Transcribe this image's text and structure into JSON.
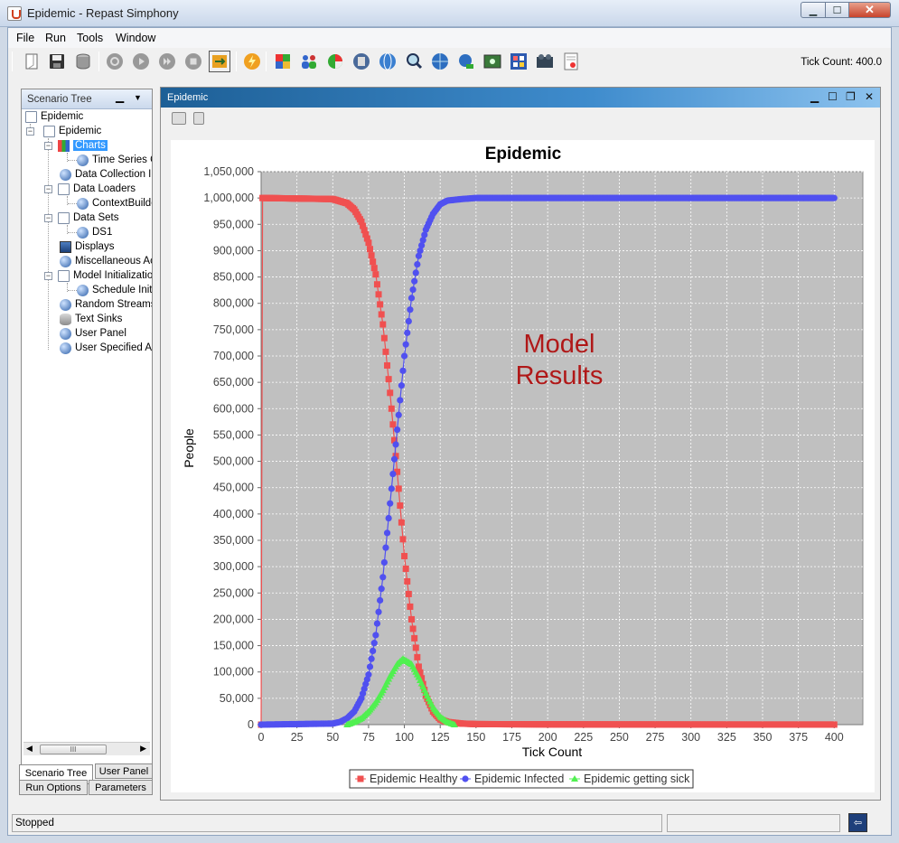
{
  "window": {
    "title": "Epidemic - Repast Simphony",
    "min_glyph": "▁",
    "max_glyph": "☐",
    "close_glyph": "✕"
  },
  "menu": {
    "items": [
      "File",
      "Run",
      "Tools",
      "Window"
    ]
  },
  "toolbar": {
    "tick_count_label": "Tick Count: 400.0",
    "buttons": [
      {
        "icon": "open-icon"
      },
      {
        "icon": "save-icon"
      },
      {
        "icon": "database-icon"
      },
      {
        "icon": "init-icon"
      },
      {
        "icon": "play-icon"
      },
      {
        "icon": "step-icon"
      },
      {
        "icon": "stop-icon"
      },
      {
        "icon": "reset-icon"
      },
      {
        "icon": "flash-icon"
      },
      {
        "icon": "colors-icon"
      },
      {
        "icon": "people-icon"
      },
      {
        "icon": "pie-icon"
      },
      {
        "icon": "calculator-icon"
      },
      {
        "icon": "globe-icon"
      },
      {
        "icon": "magnifier-icon"
      },
      {
        "icon": "web-icon"
      },
      {
        "icon": "network-icon"
      },
      {
        "icon": "image-icon"
      },
      {
        "icon": "grid-icon"
      },
      {
        "icon": "film-icon"
      },
      {
        "icon": "report-icon"
      }
    ]
  },
  "scenario_tree": {
    "header": "Scenario Tree",
    "nodes": [
      {
        "label": "Epidemic"
      },
      {
        "label": "Epidemic"
      },
      {
        "label": "Charts"
      },
      {
        "label": "Time Series C"
      },
      {
        "label": "Data Collection In"
      },
      {
        "label": "Data Loaders"
      },
      {
        "label": "ContextBuilde"
      },
      {
        "label": "Data Sets"
      },
      {
        "label": "DS1"
      },
      {
        "label": "Displays"
      },
      {
        "label": "Miscellaneous Act"
      },
      {
        "label": "Model Initializatio"
      },
      {
        "label": "Schedule Init"
      },
      {
        "label": "Random Streams"
      },
      {
        "label": "Text Sinks"
      },
      {
        "label": "User Panel"
      },
      {
        "label": "User Specified Ac"
      }
    ],
    "scroll_thumb": "III"
  },
  "bottom_tabs": {
    "scenario_tree": "Scenario Tree",
    "user_panel": "User Panel",
    "run_options": "Run Options",
    "parameters": "Parameters"
  },
  "chart_window": {
    "title": "Epidemic"
  },
  "annotation": {
    "line1": "Model",
    "line2": "Results"
  },
  "status": {
    "text": "Stopped"
  },
  "chart_data": {
    "type": "line",
    "title": "Epidemic",
    "xlabel": "Tick Count",
    "ylabel": "People",
    "xlim": [
      0,
      420
    ],
    "ylim": [
      0,
      1050000
    ],
    "x_ticks": [
      0,
      25,
      50,
      75,
      100,
      125,
      150,
      175,
      200,
      225,
      250,
      275,
      300,
      325,
      350,
      375,
      400
    ],
    "y_ticks": [
      0,
      50000,
      100000,
      150000,
      200000,
      250000,
      300000,
      350000,
      400000,
      450000,
      500000,
      550000,
      600000,
      650000,
      700000,
      750000,
      800000,
      850000,
      900000,
      950000,
      1000000,
      1050000
    ],
    "grid": true,
    "legend_position": "bottom",
    "colors": {
      "healthy": "#f05050",
      "infected": "#5050f0",
      "sick": "#50f050",
      "plot_bg": "#c0c0c0",
      "annotation": "#b01818"
    },
    "series": [
      {
        "name": "Epidemic Healthy",
        "marker": "square",
        "points": [
          [
            0,
            0
          ],
          [
            1,
            1000000
          ],
          [
            50,
            998000
          ],
          [
            60,
            990000
          ],
          [
            65,
            978000
          ],
          [
            70,
            955000
          ],
          [
            75,
            915000
          ],
          [
            80,
            855000
          ],
          [
            85,
            760000
          ],
          [
            90,
            630000
          ],
          [
            95,
            480000
          ],
          [
            100,
            320000
          ],
          [
            105,
            200000
          ],
          [
            110,
            110000
          ],
          [
            115,
            55000
          ],
          [
            120,
            25000
          ],
          [
            125,
            10000
          ],
          [
            130,
            5000
          ],
          [
            140,
            2000
          ],
          [
            150,
            1000
          ],
          [
            200,
            500
          ],
          [
            250,
            300
          ],
          [
            300,
            200
          ],
          [
            350,
            100
          ],
          [
            400,
            100
          ]
        ]
      },
      {
        "name": "Epidemic Infected",
        "marker": "circle",
        "points": [
          [
            0,
            0
          ],
          [
            50,
            2000
          ],
          [
            55,
            5000
          ],
          [
            60,
            12000
          ],
          [
            65,
            25000
          ],
          [
            70,
            50000
          ],
          [
            75,
            95000
          ],
          [
            80,
            170000
          ],
          [
            85,
            280000
          ],
          [
            90,
            420000
          ],
          [
            95,
            560000
          ],
          [
            100,
            700000
          ],
          [
            105,
            810000
          ],
          [
            110,
            890000
          ],
          [
            115,
            940000
          ],
          [
            120,
            970000
          ],
          [
            125,
            988000
          ],
          [
            130,
            995000
          ],
          [
            140,
            998000
          ],
          [
            150,
            1000000
          ],
          [
            200,
            1000000
          ],
          [
            300,
            1000000
          ],
          [
            400,
            1000000
          ]
        ]
      },
      {
        "name": "Epidemic getting sick",
        "marker": "triangle",
        "points": [
          [
            60,
            0
          ],
          [
            65,
            5000
          ],
          [
            70,
            12000
          ],
          [
            75,
            25000
          ],
          [
            80,
            42000
          ],
          [
            85,
            65000
          ],
          [
            90,
            92000
          ],
          [
            95,
            115000
          ],
          [
            99,
            125000
          ],
          [
            105,
            115000
          ],
          [
            110,
            90000
          ],
          [
            115,
            60000
          ],
          [
            120,
            33000
          ],
          [
            125,
            15000
          ],
          [
            130,
            5000
          ],
          [
            135,
            0
          ]
        ]
      }
    ]
  }
}
